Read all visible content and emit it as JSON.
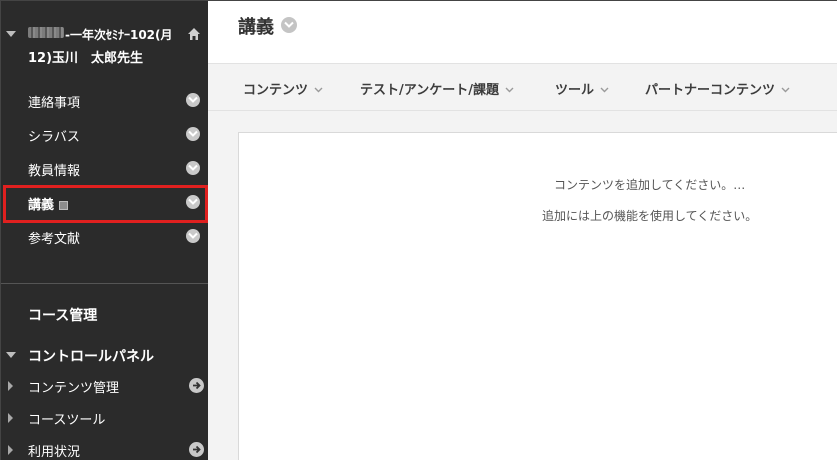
{
  "course": {
    "title_line1": "-一年次ｾﾐﾅｰ102(月",
    "title_line2": "12)玉川　太郎先生"
  },
  "sidebar": {
    "items": [
      {
        "label": "連絡事項"
      },
      {
        "label": "シラバス"
      },
      {
        "label": "教員情報"
      },
      {
        "label": "講義"
      },
      {
        "label": "参考文献"
      }
    ],
    "section_title": "コース管理",
    "control_panel": "コントロールパネル",
    "panel_items": [
      {
        "label": "コンテンツ管理"
      },
      {
        "label": "コースツール"
      },
      {
        "label": "利用状況"
      }
    ]
  },
  "main": {
    "page_title": "講義",
    "toolbar": [
      {
        "label": "コンテンツ"
      },
      {
        "label": "テスト/アンケート/課題"
      },
      {
        "label": "ツール"
      },
      {
        "label": "パートナーコンテンツ"
      }
    ],
    "empty_line1": "コンテンツを追加してください。…",
    "empty_line2": "追加には上の機能を使用してください。"
  },
  "colors": {
    "sidebar_bg": "#2b2b2b",
    "highlight": "#e0201f",
    "toolbar_bg": "#f3f3f3"
  },
  "icons": [
    "home-icon",
    "chevron-down-icon",
    "arrow-right-icon",
    "page-icon"
  ]
}
